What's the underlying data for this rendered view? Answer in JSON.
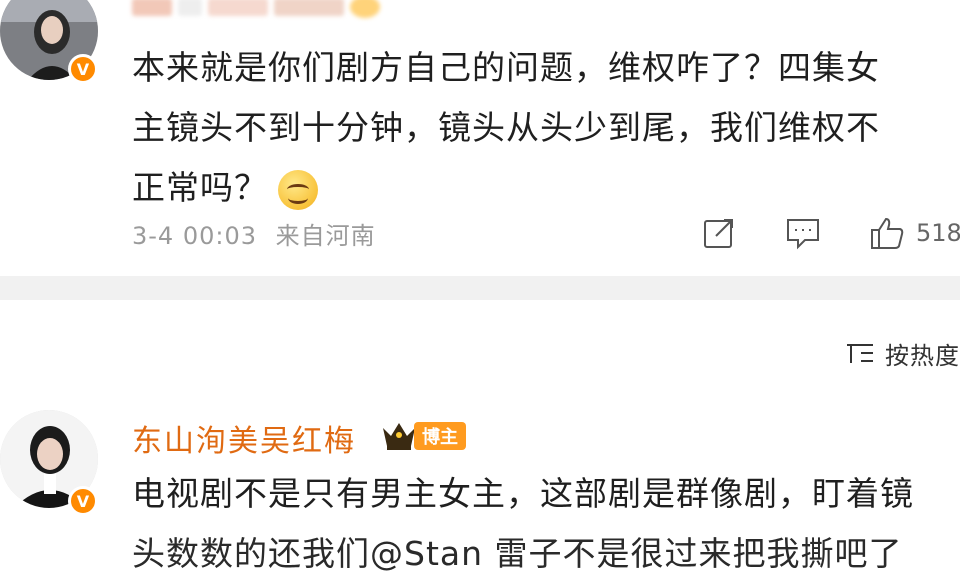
{
  "comment1": {
    "text_line1": "本来就是你们剧方自己的问题，维权咋了？四集女",
    "text_line2": "主镜头不到十分钟，镜头从头少到尾，我们维权不",
    "text_line3": "正常吗？",
    "time": "3-4 00:03",
    "location": "来自河南",
    "like_count": "518",
    "icons": [
      "share-icon",
      "comment-icon",
      "like-icon",
      "smile-emoji-icon",
      "verified-v-icon"
    ]
  },
  "sort": {
    "label": "按热度"
  },
  "comment2": {
    "username": "东山洵美吴红梅",
    "badge": "博主",
    "text_line1": "电视剧不是只有男主女主，这部剧是群像剧，盯着镜",
    "text_line2": "头数数的还我们@Stan 雷子不是很过来把我撕吧了",
    "icons": [
      "crown-icon",
      "verified-v-icon"
    ]
  },
  "colors": {
    "verified_orange": "#ff8a00",
    "username_orange": "#e06a12",
    "divider_gray": "#f1f1f1",
    "meta_gray": "#9a9a9a"
  }
}
